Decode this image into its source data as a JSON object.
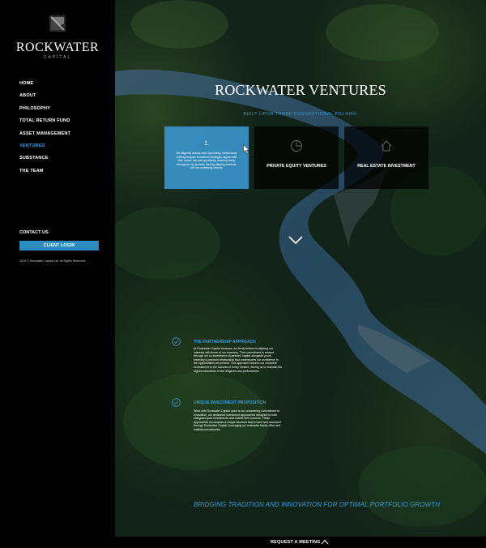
{
  "brand": {
    "name": "ROCKWATER",
    "sub": "CAPITAL"
  },
  "nav": {
    "items": [
      {
        "label": "HOME",
        "active": false
      },
      {
        "label": "ABOUT",
        "active": false
      },
      {
        "label": "PHILOSOPHY",
        "active": false
      },
      {
        "label": "TOTAL RETURN FUND",
        "active": false
      },
      {
        "label": "ASSET MANAGEMENT",
        "active": false
      },
      {
        "label": "VENTURES",
        "active": true
      },
      {
        "label": "SUBSTANCE",
        "active": false
      },
      {
        "label": "THE TEAM",
        "active": false
      }
    ],
    "contact": "CONTACT US",
    "client_login": "CLIENT LOGIN",
    "copyright": "2023 © Rockwater Capital Ltd. All Rights Reserved."
  },
  "hero": {
    "title": "ROCKWATER VENTURES",
    "subtitle": "BUILT UPON THREE FOUNDATIONAL PILLARS:",
    "cards": [
      {
        "number": "1.",
        "description": "We diligently assess each opportunity, meticulously crafting bespoke investment strategies aligned with their unique risk and opportunity, ensuring clarity throughout our process, thereby aligning investors with our underlying security.",
        "label": ""
      },
      {
        "number": "",
        "description": "",
        "label": "PRIVATE EQUITY VENTURES",
        "icon": "pie-chart-icon"
      },
      {
        "number": "",
        "description": "",
        "label": "REAL ESTATE INVESTMENT",
        "icon": "house-icon"
      }
    ]
  },
  "sections": [
    {
      "title": "THE PARTNERSHIP APPROACH",
      "body": "At Rockwater Capital Ventures, we firmly believe in aligning our interests with those of our investors. This commitment is evident through our co-investment of partners' capital alongside yours, fostering a profound relationship that underscores our confidence in the opportunities we present. This approach ensures our complete commitment to the success of every venture, driving us to maintain the highest standards of due diligence and performance."
    },
    {
      "title": "UNIQUE INVESTMENT PROPOSITION",
      "body": "What sets Rockwater Capital apart is our unwavering commitment to innovation, our dedicated investment approaches designed to both safeguard your investments and enable their success. These approaches encompass a unique structure that is used and accessed through Rockwater Capital, leveraging our extensive family office and institutional networks."
    }
  ],
  "tagline": "BRIDGING TRADITION AND INNOVATION FOR OPTIMAL PORTFOLIO GROWTH",
  "footer": {
    "request": "REQUEST A MEETING"
  },
  "colors": {
    "accent": "#3a9bd4",
    "button": "#2c8cc0",
    "sidebar": "#000000"
  }
}
